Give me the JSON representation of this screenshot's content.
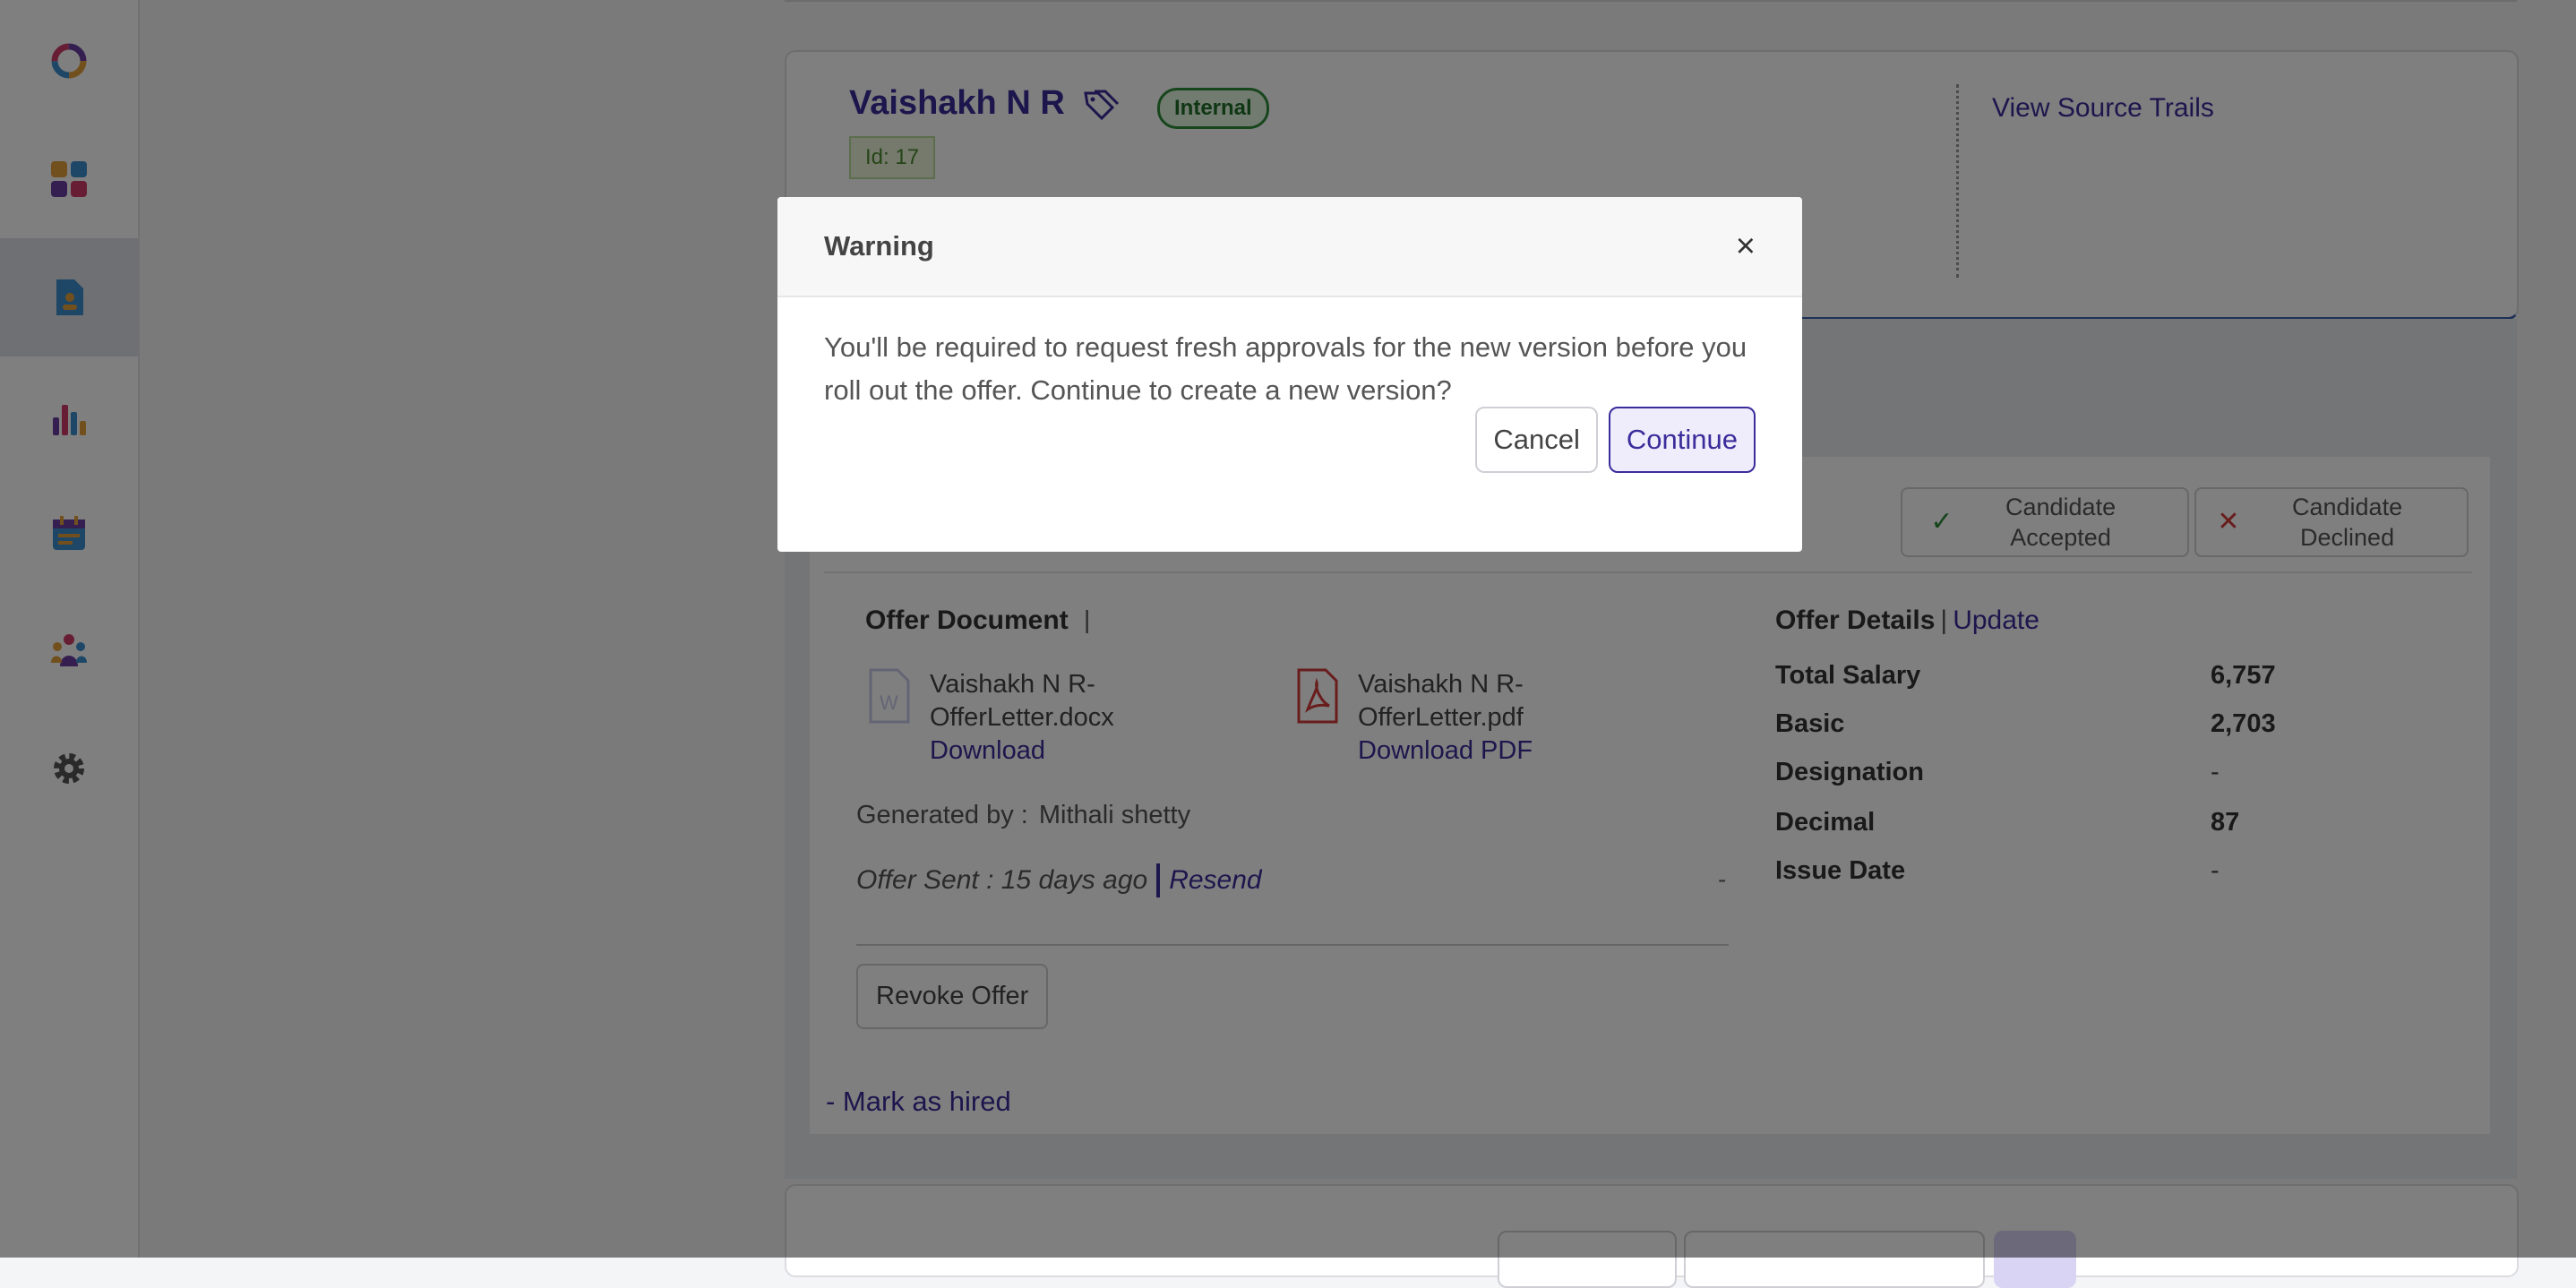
{
  "candidate": {
    "name": "Vaishakh N R",
    "badge": "Internal",
    "id_label": "Id: 17",
    "view_source_trails": "View Source Trails"
  },
  "status_buttons": {
    "accepted": "Candidate Accepted",
    "declined": "Candidate Declined"
  },
  "offer_document": {
    "title": "Offer Document",
    "separator": "|",
    "docx": {
      "filename": "Vaishakh N R-OfferLetter.docx",
      "link": "Download"
    },
    "pdf": {
      "filename": "Vaishakh N R-OfferLetter.pdf",
      "link": "Download PDF"
    },
    "generated_by_label": "Generated by :",
    "generated_by_value": "Mithali shetty",
    "offer_sent_label": "Offer Sent : 15 days ago",
    "resend": "Resend",
    "dash": "-",
    "revoke": "Revoke Offer",
    "mark_hired": "- Mark as hired"
  },
  "offer_details": {
    "title": "Offer Details",
    "separator": "|",
    "update": "Update",
    "rows": [
      {
        "label": "Total Salary",
        "value": "6,757"
      },
      {
        "label": "Basic",
        "value": "2,703"
      },
      {
        "label": "Designation",
        "value": "-"
      },
      {
        "label": "Decimal",
        "value": "87"
      },
      {
        "label": "Issue Date",
        "value": "-"
      }
    ]
  },
  "modal": {
    "title": "Warning",
    "close": "×",
    "message": "You'll be required to request fresh approvals for the new version before you roll out the offer. Continue to create a new version?",
    "cancel": "Cancel",
    "continue": "Continue"
  },
  "sidebar": {
    "items": [
      "logo-icon",
      "dashboard-icon",
      "offers-icon",
      "reports-icon",
      "calendar-icon",
      "team-icon",
      "settings-icon"
    ]
  },
  "colors": {
    "accent": "#3b2d9b",
    "internal_green": "#2f8c3a",
    "overlay": "rgba(0,0,0,0.5)"
  }
}
